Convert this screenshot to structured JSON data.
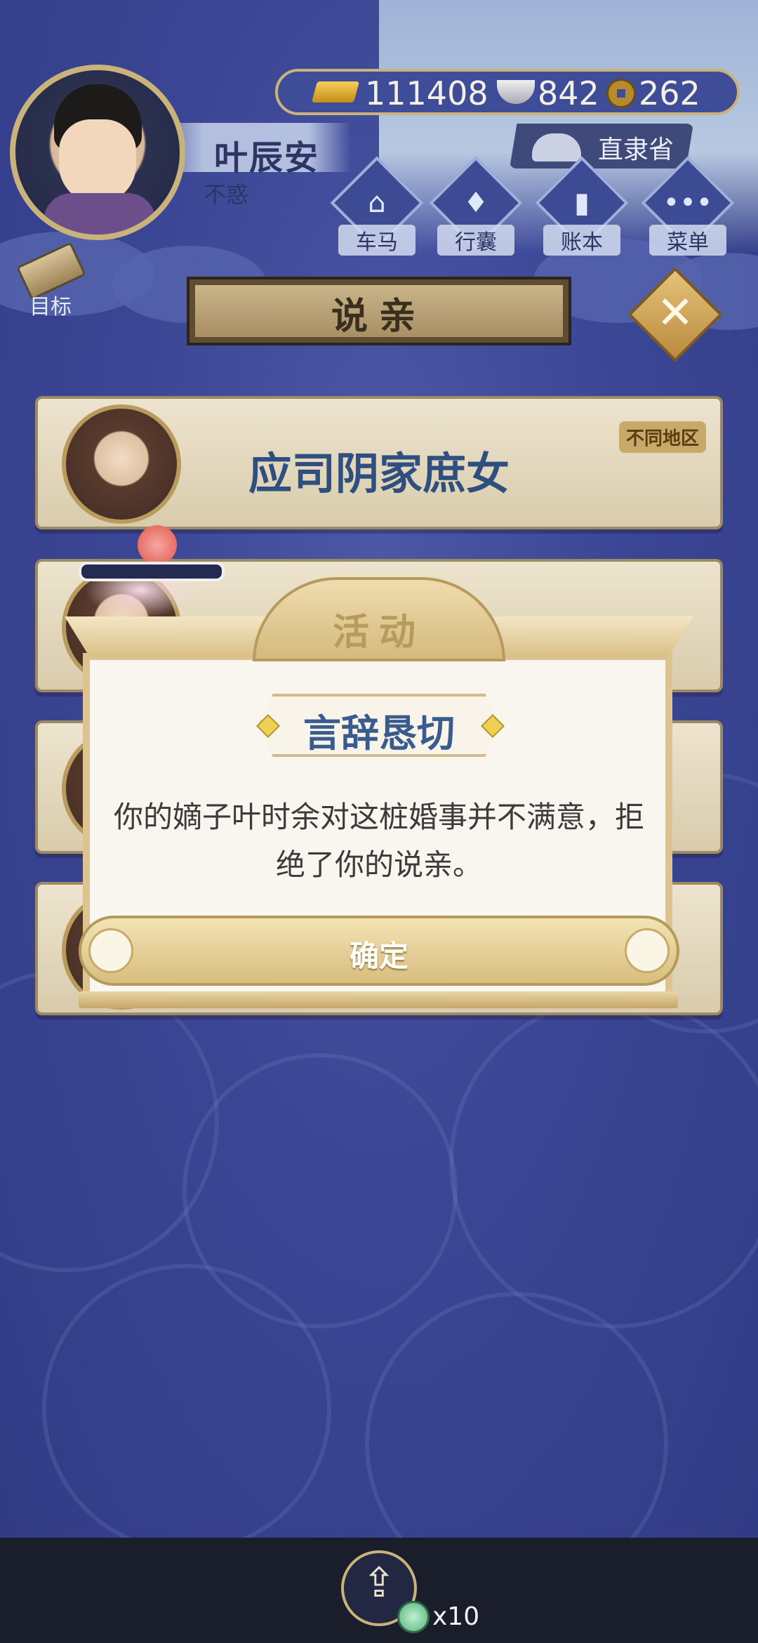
{
  "player": {
    "name": "叶辰安",
    "title": "不惑"
  },
  "resources": {
    "gold": "111408",
    "silver": "842",
    "copper": "262"
  },
  "region": "直隶省",
  "nav": [
    {
      "label": "车马",
      "icon": "carriage-icon"
    },
    {
      "label": "行囊",
      "icon": "bag-icon"
    },
    {
      "label": "账本",
      "icon": "ledger-icon"
    },
    {
      "label": "菜单",
      "icon": "menu-icon"
    }
  ],
  "goal_label": "目标",
  "page_title": "说亲",
  "cards": [
    {
      "name": "应司阴家庶女",
      "tag": "不同地区"
    },
    {
      "name": "",
      "tag": ""
    },
    {
      "name": "",
      "tag": ""
    },
    {
      "name": "",
      "tag": ""
    }
  ],
  "modal": {
    "title": "活动",
    "subtitle": "言辞恳切",
    "message": "你的嫡子叶时余对这桩婚事并不满意，拒绝了你的说亲。",
    "confirm_label": "确定"
  },
  "bottom": {
    "count": "x10"
  },
  "colors": {
    "background": "#3b4695",
    "gold_trim": "#c9b37a",
    "title_blue": "#2f4f80"
  }
}
